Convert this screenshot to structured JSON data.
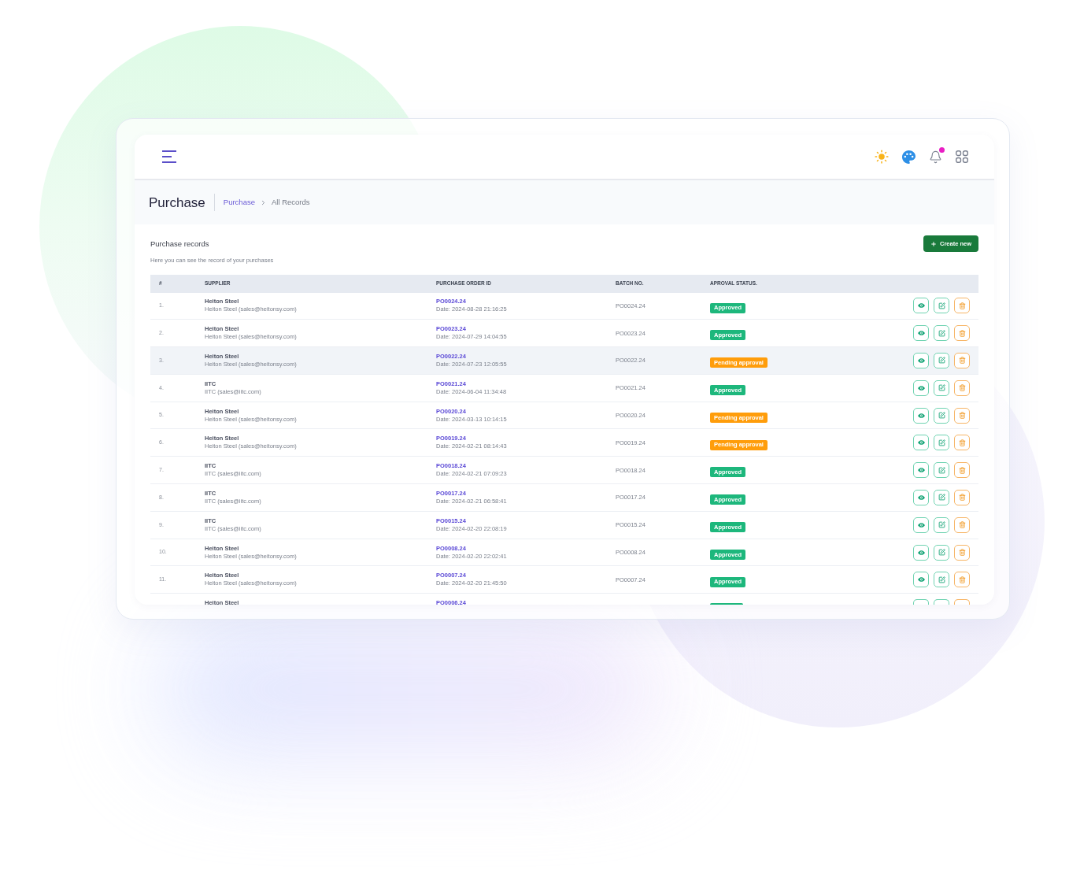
{
  "header": {
    "notification_dot": true
  },
  "page": {
    "title": "Purchase",
    "breadcrumb": [
      {
        "label": "Purchase",
        "kind": "link"
      },
      {
        "label": "All Records",
        "kind": "current"
      }
    ]
  },
  "section": {
    "title": "Purchase records",
    "subtitle": "Here you can see the record of your purchases",
    "create_button": "Create new"
  },
  "table": {
    "columns": [
      "#",
      "SUPPLIER",
      "PURCHASE ORDER ID",
      "BATCH NO.",
      "APROVAL STATUS."
    ],
    "rows": [
      {
        "number": "1.",
        "supplier_name": "Heiton Steel",
        "supplier_contact": "Heiton Steel (sales@heitonsy.com)",
        "po_id": "PO0024.24",
        "date": "Date: 2024-08-28 21:16:25",
        "batch_no": "PO0024.24",
        "status": {
          "label": "Approved",
          "kind": "approved"
        },
        "highlighted": false
      },
      {
        "number": "2.",
        "supplier_name": "Heiton Steel",
        "supplier_contact": "Heiton Steel (sales@heitonsy.com)",
        "po_id": "PO0023.24",
        "date": "Date: 2024-07-29 14:04:55",
        "batch_no": "PO0023.24",
        "status": {
          "label": "Approved",
          "kind": "approved"
        },
        "highlighted": false
      },
      {
        "number": "3.",
        "supplier_name": "Heiton Steel",
        "supplier_contact": "Heiton Steel (sales@heitonsy.com)",
        "po_id": "PO0022.24",
        "date": "Date: 2024-07-23 12:05:55",
        "batch_no": "PO0022.24",
        "status": {
          "label": "Pending approval",
          "kind": "pending"
        },
        "highlighted": true
      },
      {
        "number": "4.",
        "supplier_name": "IITC",
        "supplier_contact": "IITC (sales@iitc.com)",
        "po_id": "PO0021.24",
        "date": "Date: 2024-06-04 11:34:48",
        "batch_no": "PO0021.24",
        "status": {
          "label": "Approved",
          "kind": "approved"
        },
        "highlighted": false
      },
      {
        "number": "5.",
        "supplier_name": "Heiton Steel",
        "supplier_contact": "Heiton Steel (sales@heitonsy.com)",
        "po_id": "PO0020.24",
        "date": "Date: 2024-03-13 10:14:15",
        "batch_no": "PO0020.24",
        "status": {
          "label": "Pending approval",
          "kind": "pending"
        },
        "highlighted": false
      },
      {
        "number": "6.",
        "supplier_name": "Heiton Steel",
        "supplier_contact": "Heiton Steel (sales@heitonsy.com)",
        "po_id": "PO0019.24",
        "date": "Date: 2024-02-21 08:14:43",
        "batch_no": "PO0019.24",
        "status": {
          "label": "Pending approval",
          "kind": "pending"
        },
        "highlighted": false
      },
      {
        "number": "7.",
        "supplier_name": "IITC",
        "supplier_contact": "IITC (sales@iitc.com)",
        "po_id": "PO0018.24",
        "date": "Date: 2024-02-21 07:09:23",
        "batch_no": "PO0018.24",
        "status": {
          "label": "Approved",
          "kind": "approved"
        },
        "highlighted": false
      },
      {
        "number": "8.",
        "supplier_name": "IITC",
        "supplier_contact": "IITC (sales@iitc.com)",
        "po_id": "PO0017.24",
        "date": "Date: 2024-02-21 06:58:41",
        "batch_no": "PO0017.24",
        "status": {
          "label": "Approved",
          "kind": "approved"
        },
        "highlighted": false
      },
      {
        "number": "9.",
        "supplier_name": "IITC",
        "supplier_contact": "IITC (sales@iitc.com)",
        "po_id": "PO0015.24",
        "date": "Date: 2024-02-20 22:08:19",
        "batch_no": "PO0015.24",
        "status": {
          "label": "Approved",
          "kind": "approved"
        },
        "highlighted": false
      },
      {
        "number": "10.",
        "supplier_name": "Heiton Steel",
        "supplier_contact": "Heiton Steel (sales@heitonsy.com)",
        "po_id": "PO0008.24",
        "date": "Date: 2024-02-20 22:02:41",
        "batch_no": "PO0008.24",
        "status": {
          "label": "Approved",
          "kind": "approved"
        },
        "highlighted": false
      },
      {
        "number": "11.",
        "supplier_name": "Heiton Steel",
        "supplier_contact": "Heiton Steel (sales@heitonsy.com)",
        "po_id": "PO0007.24",
        "date": "Date: 2024-02-20 21:45:50",
        "batch_no": "PO0007.24",
        "status": {
          "label": "Approved",
          "kind": "approved"
        },
        "highlighted": false
      }
    ],
    "cut_off_row": {
      "supplier_name": "Heiton Steel",
      "po_id": "PO0006.24",
      "status": {
        "kind": "approved"
      }
    }
  }
}
